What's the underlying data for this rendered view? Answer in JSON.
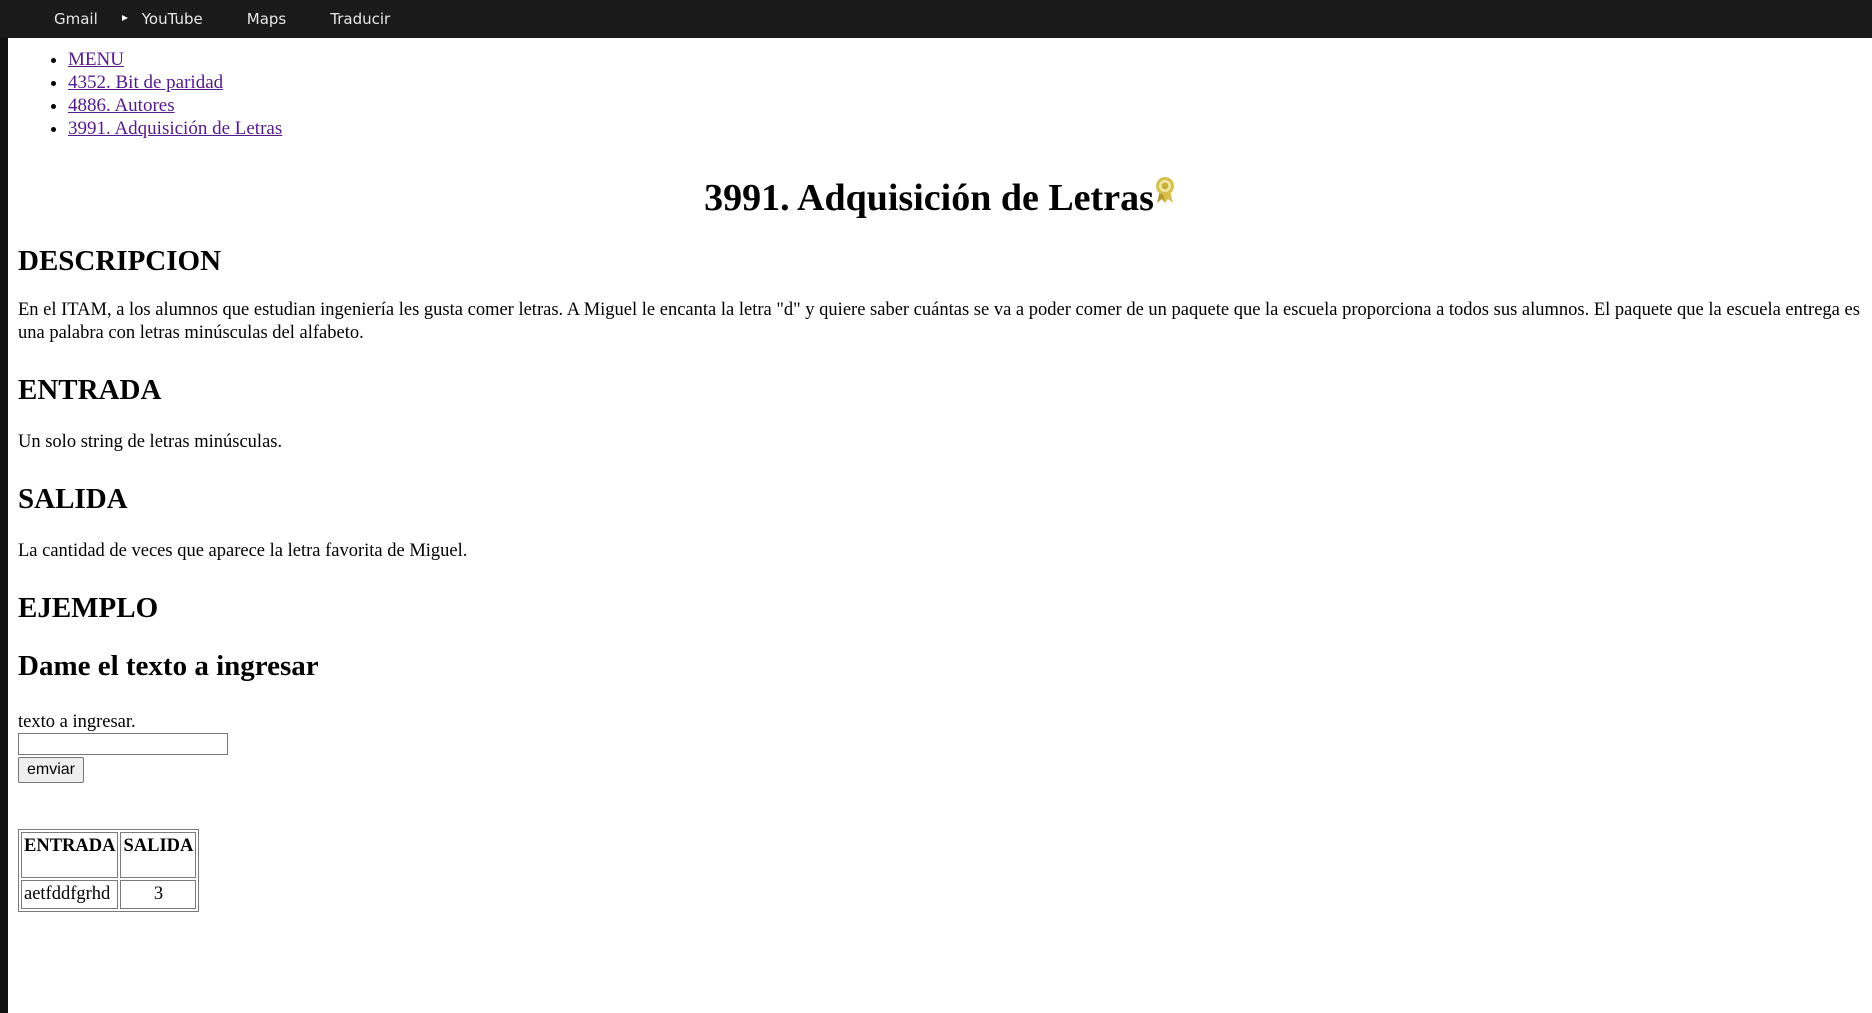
{
  "bookmarks": [
    {
      "label": "Gmail",
      "icon": "page-icon"
    },
    {
      "label": "YouTube",
      "icon": "youtube-icon"
    },
    {
      "label": "Maps",
      "icon": "page-icon"
    },
    {
      "label": "Traducir",
      "icon": "page-icon"
    }
  ],
  "menu": {
    "items": [
      "MENU",
      "4352. Bit de paridad",
      "4886. Autores",
      "3991. Adquisición de Letras"
    ]
  },
  "page": {
    "title": "3991. Adquisición de Letras",
    "title_icon": "award-icon",
    "sections": {
      "descripcion_heading": "DESCRIPCION",
      "descripcion_text": "En el ITAM, a los alumnos que estudian ingeniería les gusta comer letras. A Miguel le encanta la letra \"d\" y quiere saber cuántas se va a poder comer de un paquete que la escuela proporciona a todos sus alumnos. El paquete que la escuela entrega es una palabra con letras minúsculas del alfabeto.",
      "entrada_heading": "ENTRADA",
      "entrada_text": "Un solo string de letras minúsculas.",
      "salida_heading": "SALIDA",
      "salida_text": "La cantidad de veces que aparece la letra favorita de Miguel.",
      "ejemplo_heading": "EJEMPLO"
    },
    "form": {
      "heading": "Dame el texto a ingresar",
      "label": "texto a ingresar.",
      "input_value": "",
      "button_label": "emviar"
    },
    "table": {
      "headers": [
        "ENTRADA",
        "SALIDA"
      ],
      "rows": [
        [
          "aetfddfgrhd",
          "3"
        ]
      ]
    }
  },
  "colors": {
    "link_visited": "#551a8b",
    "bookmarks_bar": "#1a1a1a",
    "youtube_red": "#ff0000",
    "award_gold": "#c9b23c"
  }
}
